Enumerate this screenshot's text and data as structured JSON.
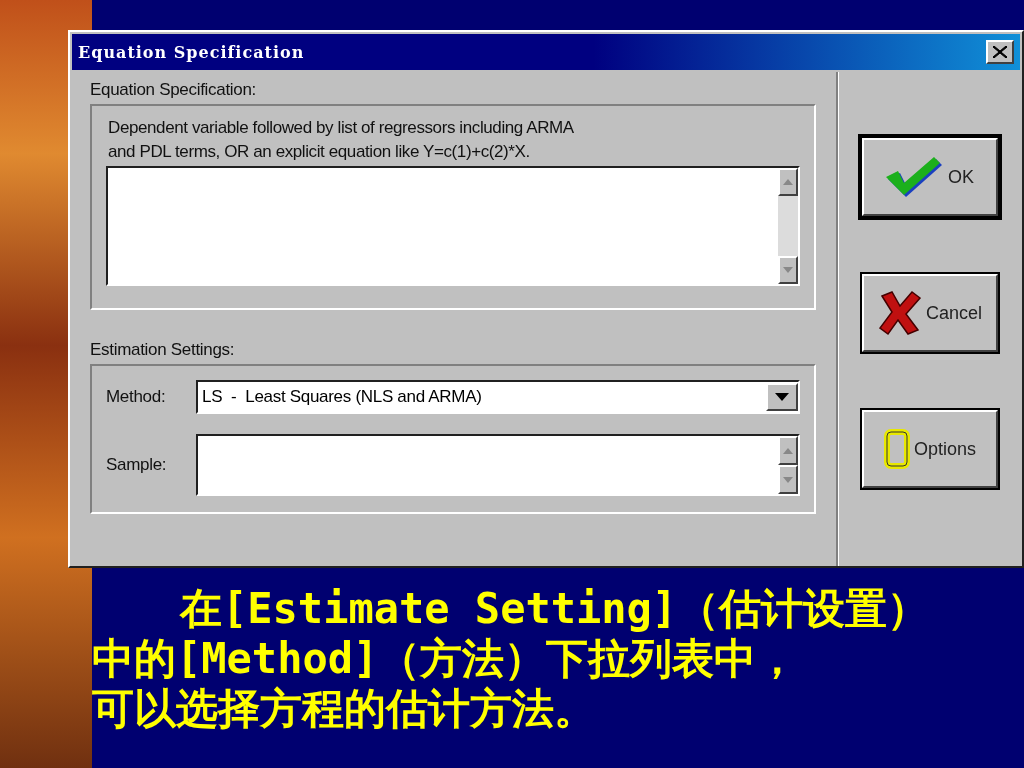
{
  "window": {
    "title": "Equation Specification"
  },
  "equation_specification": {
    "label": "Equation Specification:",
    "instructions": "Dependent variable followed by list of regressors including ARMA\nand PDL terms, OR an explicit equation like Y=c(1)+c(2)*X."
  },
  "estimation_settings": {
    "label": "Estimation Settings:",
    "method": {
      "label": "Method:",
      "value": "LS  -  Least Squares (NLS and ARMA)"
    },
    "sample": {
      "label": "Sample:"
    }
  },
  "buttons": [
    {
      "label": "OK",
      "kind": "ok"
    },
    {
      "label": "Cancel",
      "kind": "cancel"
    },
    {
      "label": "Options",
      "kind": "options"
    }
  ],
  "caption": [
    "在[Estimate Setting]（估计设置）",
    "中的[Method]（方法）下拉列表中，",
    "可以选择方程的估计方法。"
  ]
}
